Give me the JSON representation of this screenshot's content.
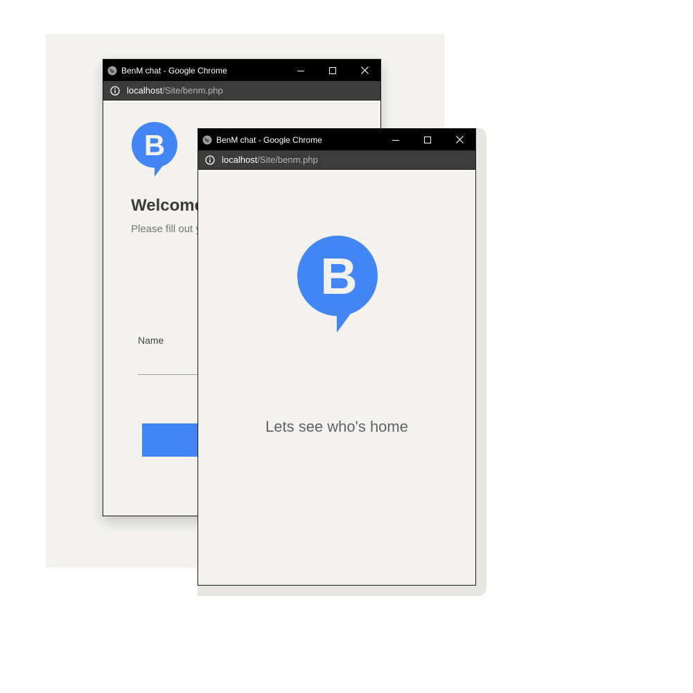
{
  "colors": {
    "brand": "#4285f4",
    "titlebar": "#000000",
    "addressbar": "#3c3c3c",
    "page_bg": "#f3f2ef"
  },
  "back_window": {
    "title": "BenM chat - Google Chrome",
    "url_host": "localhost",
    "url_path": "/Site/benm.php",
    "logo_letter": "B",
    "welcome": "Welcome",
    "subtitle": "Please fill out y",
    "name_label": "Name",
    "name_value": "",
    "button_label": ""
  },
  "front_window": {
    "title": "BenM chat - Google Chrome",
    "url_host": "localhost",
    "url_path": "/Site/benm.php",
    "logo_letter": "B",
    "status_text": "Lets see who's home"
  },
  "icons": [
    "globe-icon",
    "minimize-icon",
    "maximize-icon",
    "close-icon",
    "info-icon",
    "benm-logo-icon"
  ]
}
